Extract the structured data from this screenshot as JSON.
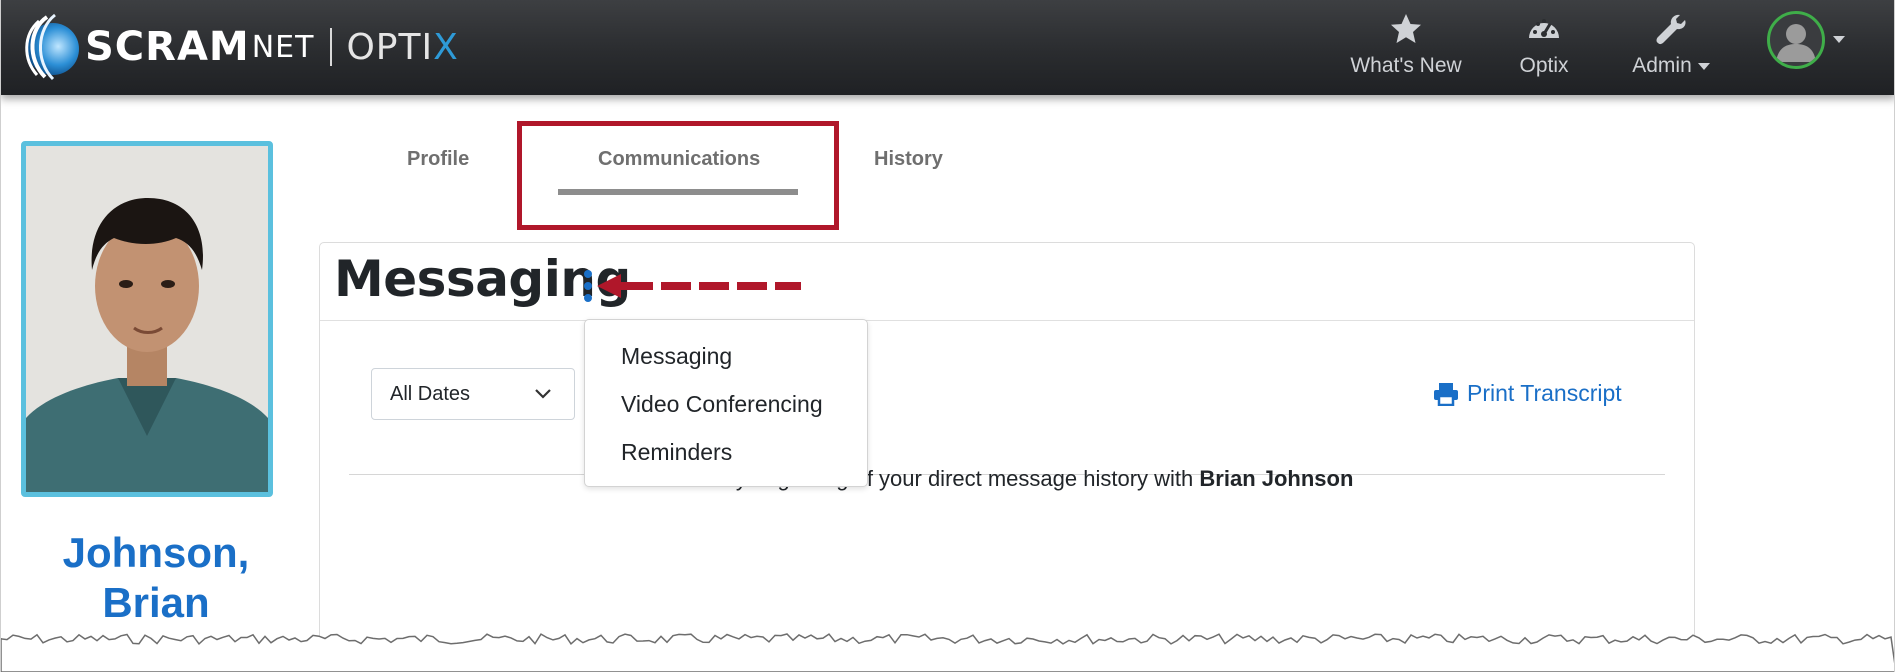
{
  "navbar": {
    "logo": {
      "brand": "SCRAM",
      "brand_suffix": "NET",
      "product": "OPTI",
      "product_x": "X"
    },
    "items": [
      {
        "label": "What's New",
        "icon": "star-icon"
      },
      {
        "label": "Optix",
        "icon": "dashboard-gauge-icon"
      },
      {
        "label": "Admin",
        "icon": "wrench-icon",
        "has_caret": true
      }
    ],
    "user_menu": {
      "icon": "user-avatar-icon",
      "status_color": "#3fae49"
    }
  },
  "profile": {
    "name_line1": "Johnson,",
    "name_line2": "Brian",
    "photo_border_color": "#5bc0de"
  },
  "tabs": [
    {
      "label": "Profile",
      "active": false
    },
    {
      "label": "Communications",
      "active": true
    },
    {
      "label": "History",
      "active": false
    }
  ],
  "messaging": {
    "title": "Messaging",
    "date_filter": {
      "selected": "All Dates"
    },
    "print_label": "Print Transcript",
    "history_prefix": "This is the very beginning of your direct message history with ",
    "history_name": "Brian Johnson"
  },
  "dropdown": {
    "items": [
      "Messaging",
      "Video Conferencing",
      "Reminders"
    ]
  },
  "colors": {
    "accent_blue": "#1a6fc7",
    "callout_red": "#b0172a",
    "navbar_dark": "#2a2c2f"
  }
}
